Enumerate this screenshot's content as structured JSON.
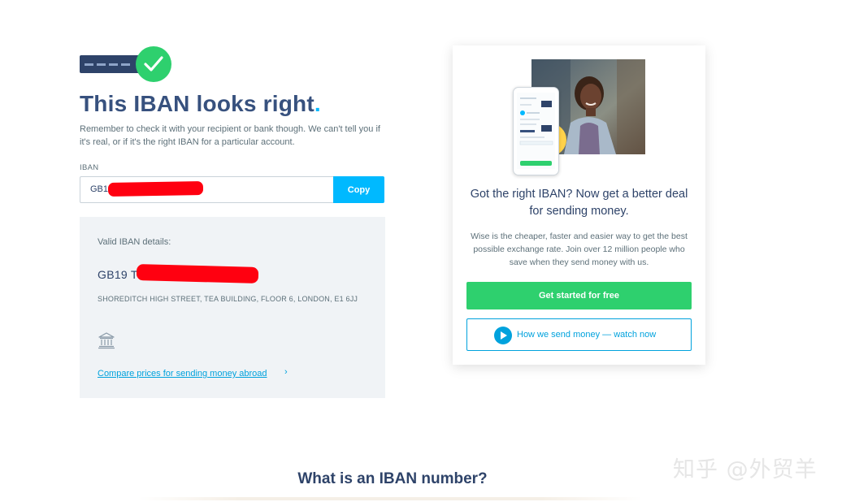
{
  "result": {
    "title": "This IBAN looks right",
    "title_dot": ".",
    "intro": "Remember to check it with your recipient or bank though. We can't tell you if it's real, or if it's the right IBAN for a particular account."
  },
  "iban_field": {
    "label": "IBAN",
    "value": "GB19",
    "copy_label": "Copy"
  },
  "details": {
    "heading": "Valid IBAN details:",
    "iban_display": "GB19 T                                   81",
    "address": "SHOREDITCH HIGH STREET, TEA BUILDING, FLOOR 6, LONDON, E1 6JJ",
    "compare_link": "Compare prices for sending money abroad",
    "chevron": "›"
  },
  "promo": {
    "heading": "Got the right IBAN? Now get a better deal for sending money.",
    "text": "Wise is the cheaper, faster and easier way to get the best possible exchange rate. Join over 12 million people who save when they send money with us.",
    "primary_button": "Get started for free",
    "secondary_button": "How we send money — watch now"
  },
  "section": {
    "title": "What is an IBAN number?"
  },
  "watermark": "知乎 @外贸羊",
  "colors": {
    "navy": "#37517e",
    "accent_blue": "#00b9ff",
    "green": "#2ed06e",
    "card_bg": "#f0f3f6",
    "redaction": "#ff0010"
  }
}
